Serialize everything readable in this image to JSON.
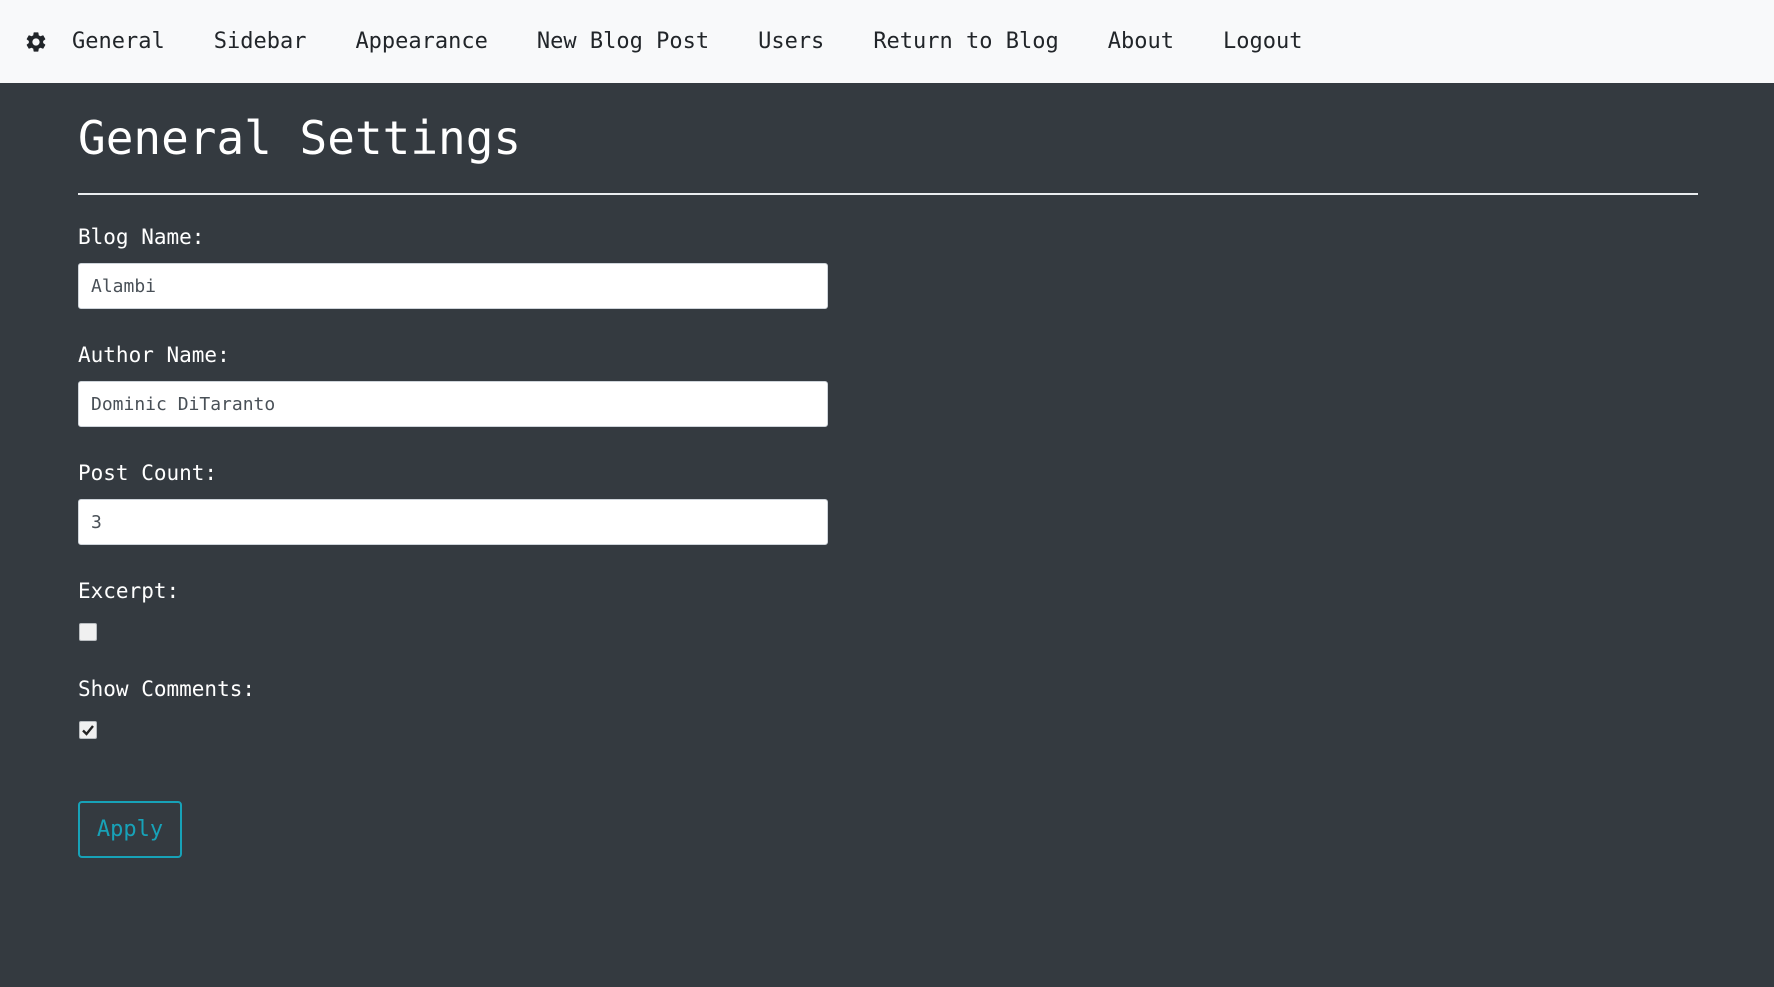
{
  "nav": {
    "icon": "gear-icon",
    "items": [
      {
        "label": "General"
      },
      {
        "label": "Sidebar"
      },
      {
        "label": "Appearance"
      },
      {
        "label": "New Blog Post"
      },
      {
        "label": "Users"
      },
      {
        "label": "Return to Blog"
      },
      {
        "label": "About"
      },
      {
        "label": "Logout"
      }
    ]
  },
  "page": {
    "title": "General Settings"
  },
  "form": {
    "blog_name": {
      "label": "Blog Name:",
      "value": "Alambi"
    },
    "author_name": {
      "label": "Author Name:",
      "value": "Dominic DiTaranto"
    },
    "post_count": {
      "label": "Post Count:",
      "value": "3"
    },
    "excerpt": {
      "label": "Excerpt:",
      "checked": false
    },
    "show_comments": {
      "label": "Show Comments:",
      "checked": true
    },
    "apply_label": "Apply"
  },
  "colors": {
    "background": "#343a40",
    "navbar": "#f8f9fa",
    "accent": "#17a2b8"
  }
}
